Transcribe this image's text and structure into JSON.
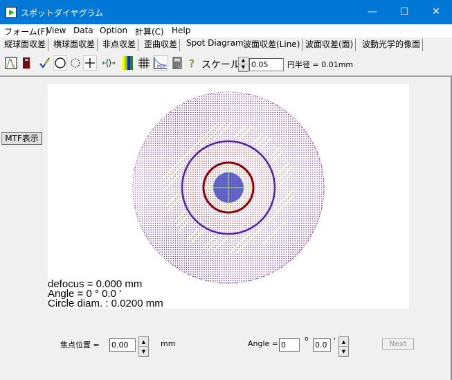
{
  "window": {
    "title": "スポットダイヤグラム",
    "icon": "app-lens-icon",
    "controls": {
      "minimize": "—",
      "maximize": "☐",
      "close": "✕"
    }
  },
  "menu": [
    "フォーム(F)",
    "View",
    "Data",
    "Option",
    "計算(C)",
    "Help"
  ],
  "tabs": [
    {
      "label": "縦球面収差",
      "active": false
    },
    {
      "label": "横球面収差",
      "active": false
    },
    {
      "label": "非点収差",
      "active": false
    },
    {
      "label": "歪曲収差",
      "active": false
    },
    {
      "label": "Spot Diagram",
      "active": true
    },
    {
      "label": "波面収差(Line)",
      "active": false
    },
    {
      "label": "波面収差(面)",
      "active": false
    },
    {
      "label": "波動光学的像面",
      "active": false
    }
  ],
  "toolbar": {
    "icons": [
      "chart-icon",
      "exit-door-icon",
      "pencil-check-icon",
      "circle-icon",
      "dotted-circle-icon",
      "crosshair-icon",
      "lens-arrows-icon",
      "color-bars-icon",
      "grid-icon",
      "mtf-icon",
      "calculator-icon",
      "help-icon"
    ],
    "scale_label": "スケール",
    "scale_value": "0.05",
    "radius_text": "円半径 = 0.01mm"
  },
  "side": {
    "mtf_button": "MTF表示"
  },
  "plot": {
    "defocus": "defocus = 0.000 mm",
    "angle": "Angle   = 0 °  0.0 '",
    "circle": "Circle diam. : 0.0200 mm"
  },
  "bottom": {
    "focus_label": "焦点位置 =",
    "focus_value": "0.00",
    "focus_unit": "mm",
    "angle_label": "Angle =",
    "angle_deg": "0",
    "deg_symbol": "o",
    "angle_min": "0.0",
    "min_symbol": "'",
    "next_button": "Next"
  },
  "colors": {
    "titlebar": "#0078d7",
    "spot_outer": "#7a1fa0",
    "spot_mid": "#8b0000",
    "spot_core": "#3030b0",
    "spot_accent": "#e0c020"
  }
}
